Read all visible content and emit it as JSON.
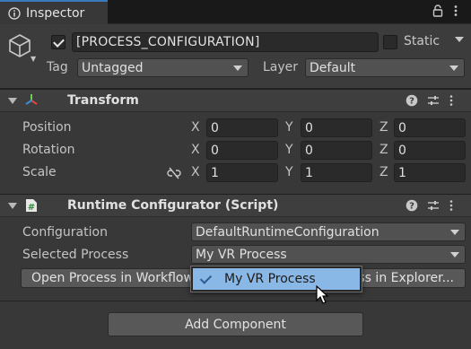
{
  "tab": {
    "title": "Inspector",
    "icon": "info-icon"
  },
  "tab_actions": [
    "lock-icon",
    "more-vertical-icon"
  ],
  "gameobject": {
    "icon": "cube-icon",
    "active": true,
    "name": "[PROCESS_CONFIGURATION]",
    "static_label": "Static",
    "static_checked": false,
    "tag_label": "Tag",
    "tag_value": "Untagged",
    "layer_label": "Layer",
    "layer_value": "Default"
  },
  "transform": {
    "title": "Transform",
    "icon": "transform-axes-icon",
    "rows": [
      {
        "label": "Position",
        "x": "0",
        "y": "0",
        "z": "0"
      },
      {
        "label": "Rotation",
        "x": "0",
        "y": "0",
        "z": "0"
      },
      {
        "label": "Scale",
        "x": "1",
        "y": "1",
        "z": "1"
      }
    ],
    "axes": [
      "X",
      "Y",
      "Z"
    ]
  },
  "runtime_configurator": {
    "title": "Runtime Configurator (Script)",
    "icon": "csharp-script-icon",
    "configuration_label": "Configuration",
    "configuration_value": "DefaultRuntimeConfiguration",
    "selected_process_label": "Selected Process",
    "selected_process_value": "My VR Process",
    "open_workflow_button": "Open Process in Workflow",
    "open_explorer_button": "Show Process in Explorer..."
  },
  "popup": {
    "items": [
      {
        "label": "My VR Process",
        "selected": true
      }
    ]
  },
  "add_component_button": "Add Component",
  "colors": {
    "background": "#383838",
    "tab_accent": "#3a79bb",
    "selection": "#8ab8e6",
    "field": "#2a2a2a"
  }
}
